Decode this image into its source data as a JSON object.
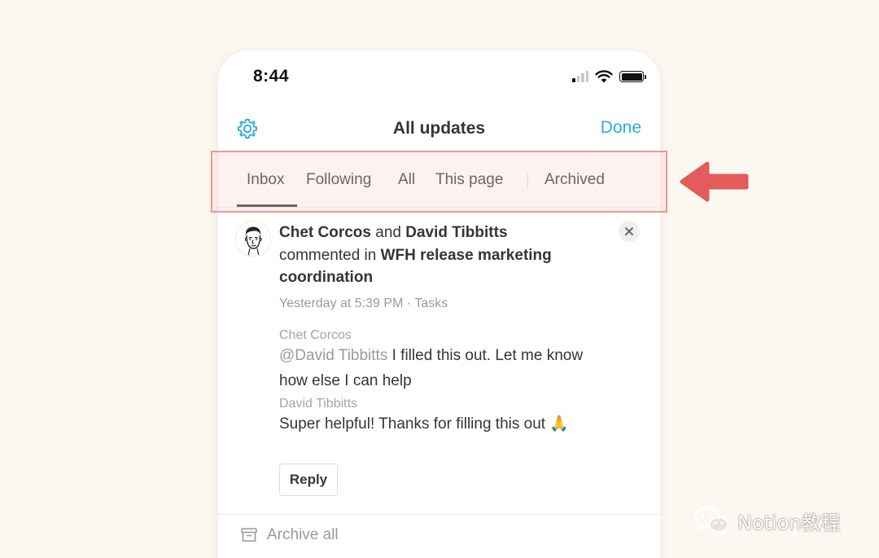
{
  "status_bar": {
    "time": "8:44"
  },
  "header": {
    "title": "All updates",
    "done_label": "Done"
  },
  "tabs": [
    {
      "label": "Inbox",
      "active": true
    },
    {
      "label": "Following",
      "active": false
    },
    {
      "label": "All",
      "active": false
    },
    {
      "label": "This page",
      "active": false
    },
    {
      "label": "Archived",
      "active": false
    }
  ],
  "notification": {
    "actor_1": "Chet Corcos",
    "conjunction": "and",
    "actor_2": "David Tibbitts",
    "action": "commented in",
    "page_title_line1": "WFH release marketing",
    "page_title_line2": "coordination",
    "timestamp": "Yesterday at 5:39 PM",
    "separator": "·",
    "location": "Tasks",
    "comments": [
      {
        "author": "Chet Corcos",
        "mention": "@David Tibbitts",
        "text_line1": " I filled this out. Let me know",
        "text_line2": "how else I can help"
      },
      {
        "author": "David Tibbitts",
        "text": "Super helpful! Thanks for filling this out",
        "emoji": "🙏"
      }
    ],
    "reply_label": "Reply"
  },
  "footer": {
    "archive_all_label": "Archive all"
  },
  "watermark": {
    "text": "Notion教程"
  },
  "colors": {
    "accent": "#2eaadc",
    "background": "#fcf7f1",
    "highlight": "#ec7878",
    "arrow": "#e35b5b"
  },
  "icons": {
    "settings": "gear-icon",
    "close": "close-icon",
    "archive": "archive-box-icon",
    "annotation": "arrow-left-icon"
  }
}
